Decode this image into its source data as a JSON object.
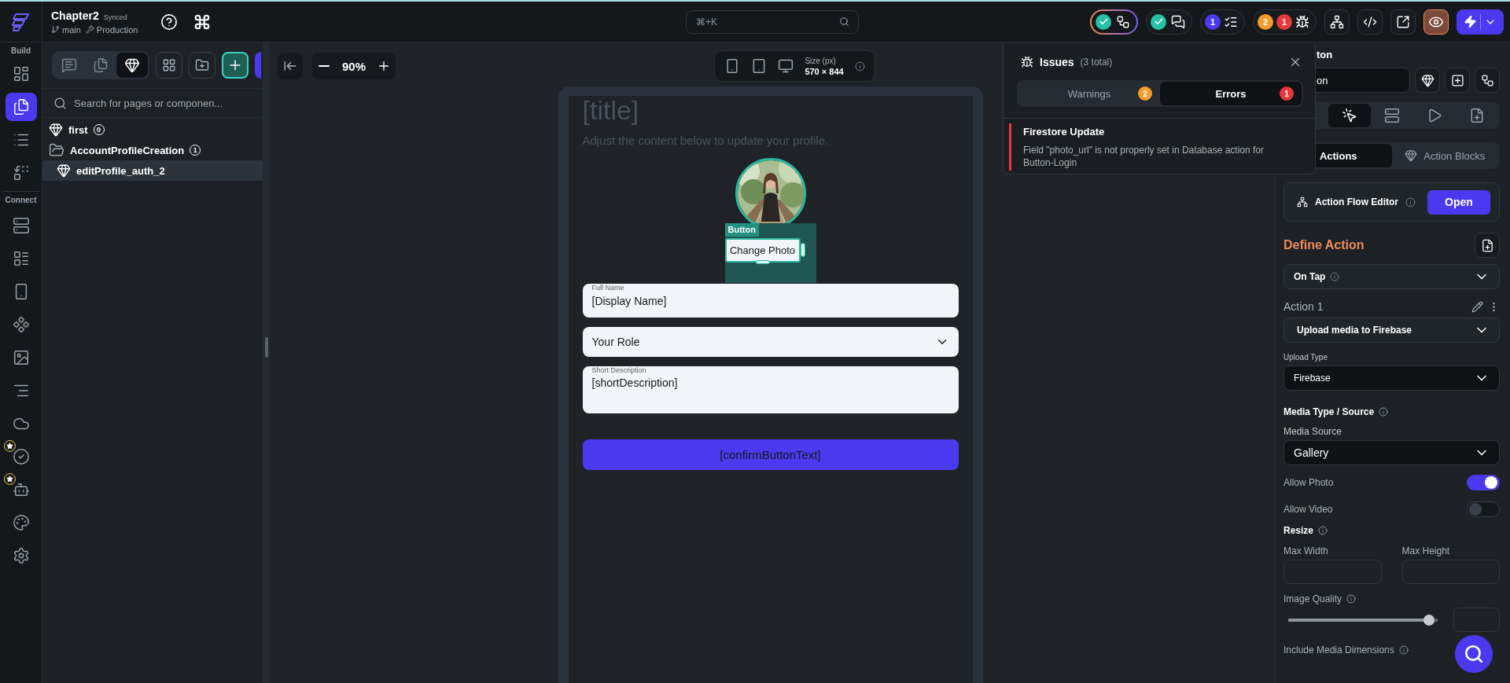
{
  "top_bar": {
    "project": "Chapter2",
    "sync_status": "Synced",
    "branch": "main",
    "environment": "Production",
    "search": {
      "placeholder": "⌘+K"
    },
    "status_groups": [
      {
        "ok": true
      },
      {
        "ok": true
      },
      {
        "badges": [
          {
            "count": "1",
            "color": "#4b39ef"
          }
        ]
      },
      {
        "badges": [
          {
            "count": "2",
            "color": "#f39c2b"
          },
          {
            "count": "1",
            "color": "#e5393b"
          }
        ]
      }
    ],
    "preview_on": true
  },
  "rail": {
    "build_label": "Build",
    "build_items": [
      {
        "selected": false,
        "starred": false
      },
      {
        "selected": true,
        "starred": false
      },
      {
        "selected": false,
        "starred": false
      },
      {
        "selected": false,
        "starred": false
      }
    ],
    "connect_label": "Connect",
    "connect_items": [
      {
        "selected": false,
        "starred": false
      },
      {
        "selected": false,
        "starred": false
      },
      {
        "selected": false,
        "starred": false
      },
      {
        "selected": false,
        "starred": false
      },
      {
        "selected": false,
        "starred": false
      },
      {
        "selected": false,
        "starred": false
      },
      {
        "selected": false,
        "starred": false
      },
      {
        "selected": false,
        "starred": true
      },
      {
        "selected": false,
        "starred": true
      },
      {
        "selected": false,
        "starred": false
      },
      {
        "selected": false,
        "starred": false
      }
    ]
  },
  "left_panel": {
    "view_tabs": [
      {
        "selected": false
      },
      {
        "selected": false
      },
      {
        "selected": true
      }
    ],
    "search": {
      "placeholder": "Search for pages or componen..."
    },
    "tree": [
      {
        "label": "first",
        "count": "0",
        "selected": false
      },
      {
        "label": "AccountProfileCreation",
        "count": "1",
        "selected": false,
        "children": [
          {
            "label": "editProfile_auth_2",
            "selected": true
          }
        ]
      }
    ]
  },
  "canvas": {
    "zoom": "90%",
    "size_label": "Size (px)",
    "size_value": "570 × 844",
    "page": {
      "title": "[title]",
      "subtitle": "Adjust the content below to update your profile.",
      "selection_tag": "Button",
      "photo_button": "Change Photo",
      "fields": [
        {
          "kind": "text",
          "label": "Full Name",
          "value": "[Display Name]"
        },
        {
          "kind": "dropdown",
          "value": "Your Role"
        },
        {
          "kind": "textarea",
          "label": "Short Description",
          "value": "[shortDescription]"
        }
      ],
      "confirm_button": "[confirmButtonText]"
    }
  },
  "issues": {
    "title": "Issues",
    "total": "(3 total)",
    "tabs": [
      {
        "label": "Warnings",
        "count": "2",
        "color": "#f39c2b",
        "selected": false
      },
      {
        "label": "Errors",
        "count": "1",
        "color": "#e5393b",
        "selected": true
      }
    ],
    "items": [
      {
        "title": "Firestore Update",
        "message": "Field \"photo_url\" is not properly set in Database action for Button-Login"
      }
    ]
  },
  "properties": {
    "header": "ton",
    "name_value": "on",
    "icon_tabs": [
      {
        "selected": true
      },
      {
        "selected": false
      },
      {
        "selected": false
      },
      {
        "selected": false
      }
    ],
    "action_tabs": [
      {
        "label": "Actions",
        "selected": true
      },
      {
        "label": "Action Blocks",
        "selected": false
      }
    ],
    "flow_editor": {
      "title": "Action Flow Editor",
      "button": "Open"
    },
    "define_title": "Define Action",
    "trigger": "On Tap",
    "action_label": "Action 1",
    "action": "Upload media to Firebase",
    "upload_type": {
      "label": "Upload Type",
      "value": "Firebase"
    },
    "media_section": "Media Type / Source",
    "media_source": {
      "label": "Media Source",
      "value": "Gallery"
    },
    "toggles": [
      {
        "label": "Allow Photo",
        "on": true
      },
      {
        "label": "Allow Video",
        "on": false
      }
    ],
    "resize_section": "Resize",
    "size_fields": [
      {
        "label": "Max Width"
      },
      {
        "label": "Max Height"
      }
    ],
    "quality": {
      "label": "Image Quality",
      "level": 0.98
    },
    "dimensions_label": "Include Media Dimensions"
  }
}
